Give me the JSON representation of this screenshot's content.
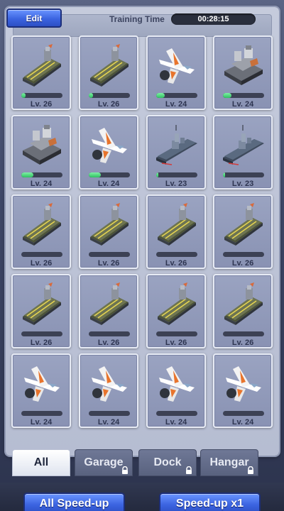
{
  "header": {
    "edit_label": "Edit",
    "training_label": "Training Time",
    "timer": "00:28:15"
  },
  "units": [
    {
      "kind": "carrier",
      "level": "Lv. 26",
      "progress": 0.1
    },
    {
      "kind": "carrier",
      "level": "Lv. 26",
      "progress": 0.1
    },
    {
      "kind": "jet",
      "level": "Lv. 24",
      "progress": 0.2
    },
    {
      "kind": "tank",
      "level": "Lv. 24",
      "progress": 0.2
    },
    {
      "kind": "tank",
      "level": "Lv. 24",
      "progress": 0.3
    },
    {
      "kind": "jet",
      "level": "Lv. 24",
      "progress": 0.3
    },
    {
      "kind": "destroyer",
      "level": "Lv. 23",
      "progress": 0.05
    },
    {
      "kind": "destroyer",
      "level": "Lv. 23",
      "progress": 0.05
    },
    {
      "kind": "carrier",
      "level": "Lv. 26",
      "progress": 0
    },
    {
      "kind": "carrier",
      "level": "Lv. 26",
      "progress": 0
    },
    {
      "kind": "carrier",
      "level": "Lv. 26",
      "progress": 0
    },
    {
      "kind": "carrier",
      "level": "Lv. 26",
      "progress": 0
    },
    {
      "kind": "carrier",
      "level": "Lv. 26",
      "progress": 0
    },
    {
      "kind": "carrier",
      "level": "Lv. 26",
      "progress": 0
    },
    {
      "kind": "carrier",
      "level": "Lv. 26",
      "progress": 0
    },
    {
      "kind": "carrier",
      "level": "Lv. 26",
      "progress": 0
    },
    {
      "kind": "jet",
      "level": "Lv. 24",
      "progress": 0
    },
    {
      "kind": "jet",
      "level": "Lv. 24",
      "progress": 0
    },
    {
      "kind": "jet",
      "level": "Lv. 24",
      "progress": 0
    },
    {
      "kind": "jet",
      "level": "Lv. 24",
      "progress": 0
    }
  ],
  "tabs": [
    {
      "label": "All",
      "active": true,
      "locked": false
    },
    {
      "label": "Garage",
      "active": false,
      "locked": true
    },
    {
      "label": "Dock",
      "active": false,
      "locked": true
    },
    {
      "label": "Hangar",
      "active": false,
      "locked": true
    }
  ],
  "buttons": {
    "all_speedup": "All Speed-up",
    "speedup_x1": "Speed-up x1"
  },
  "colors": {
    "accent_blue": "#3b63e0",
    "progress_green": "#2fbf62"
  }
}
